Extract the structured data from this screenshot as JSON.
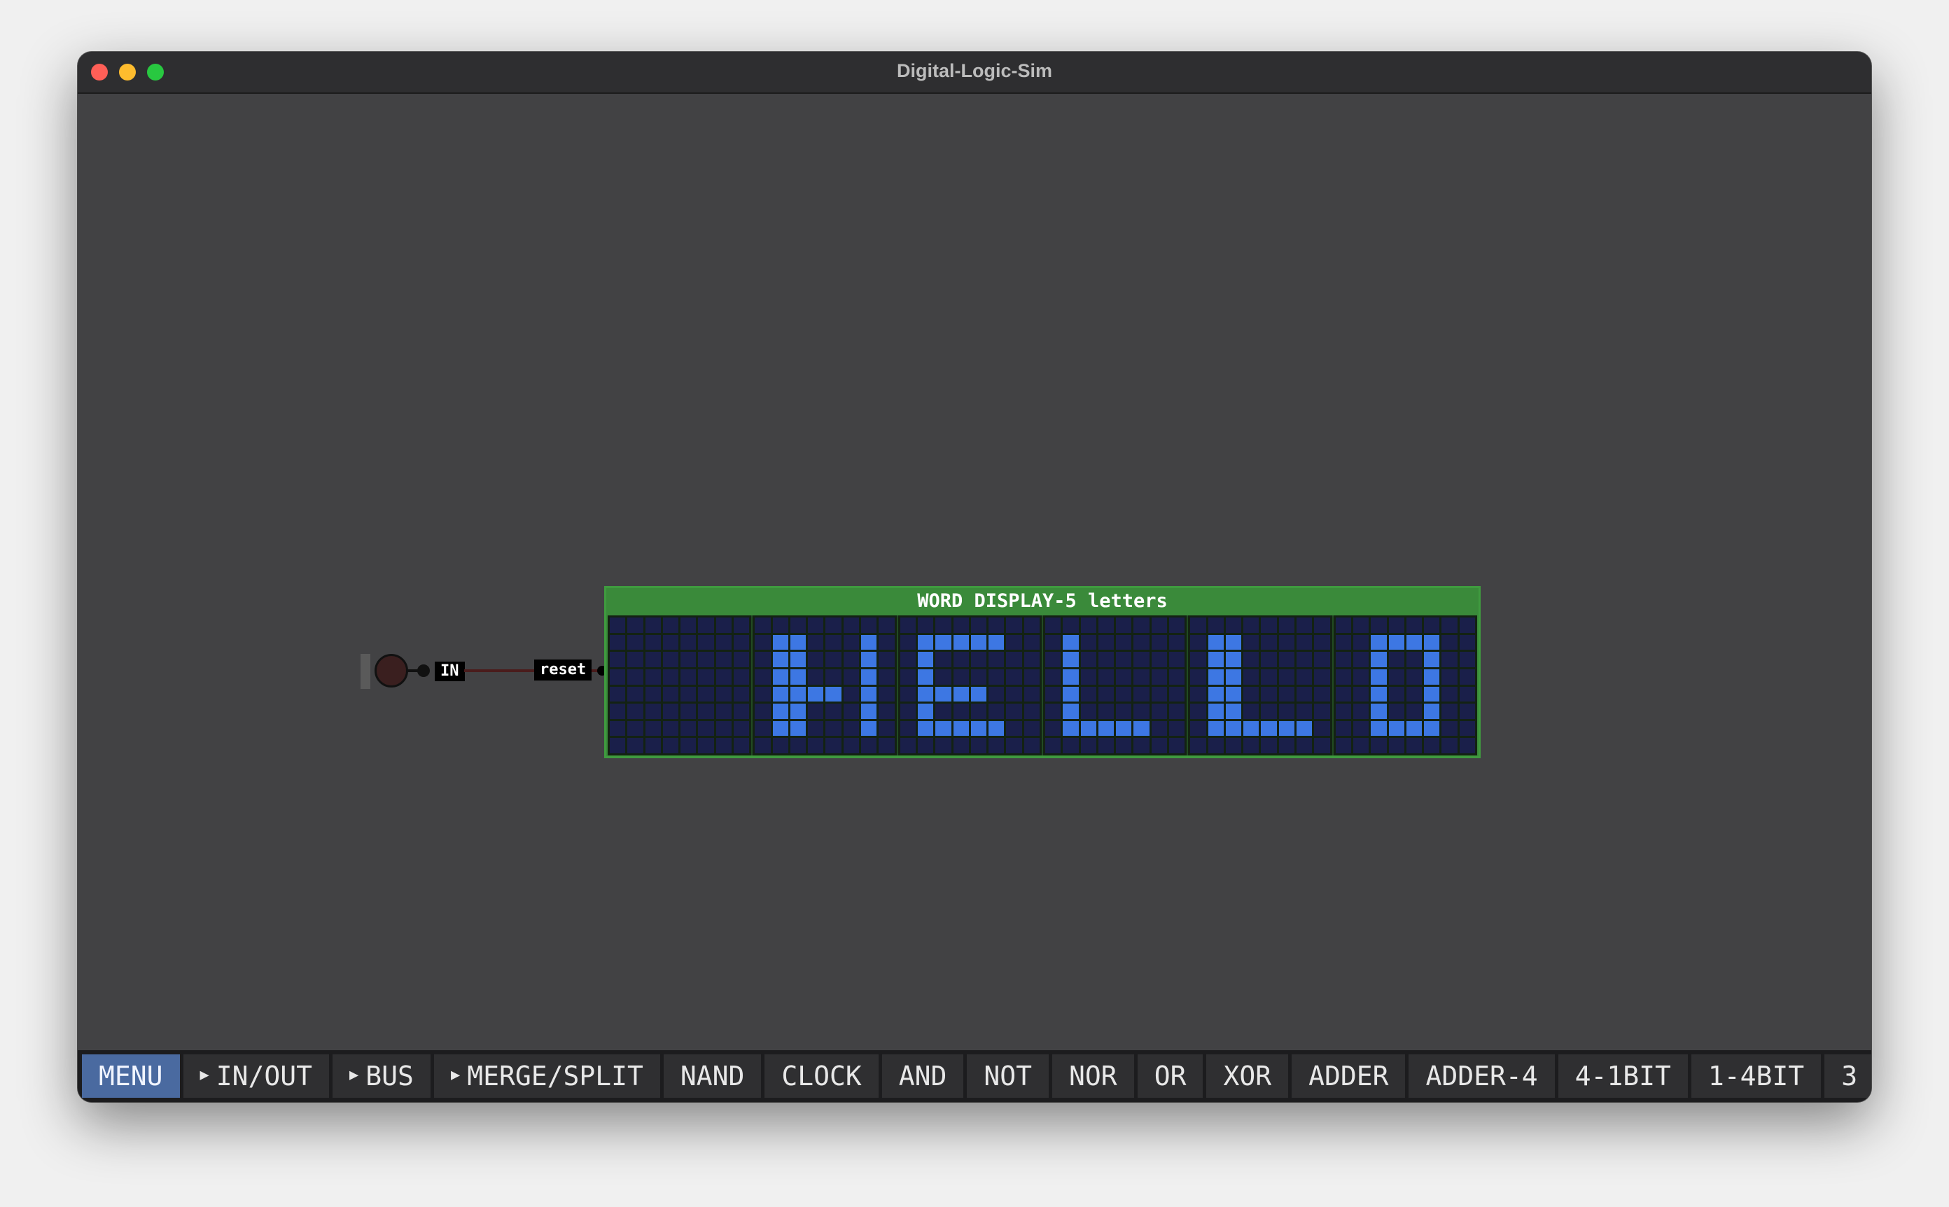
{
  "window": {
    "title": "Digital-Logic-Sim"
  },
  "canvas": {
    "input_pin": {
      "label": "IN",
      "state": "off"
    },
    "wire": {
      "color": "#4a1c1c"
    },
    "chip": {
      "title": "WORD DISPLAY-5 letters",
      "input_label": "reset",
      "colors": {
        "body": "#3a8a3a",
        "pixel_on": "#3d77e3",
        "pixel_off": "#1a1f4a"
      },
      "letters": [
        [
          "........",
          "........",
          "........",
          "........",
          "........",
          "........",
          "........",
          "........"
        ],
        [
          "........",
          ".##...#.",
          ".##...#.",
          ".##...#.",
          ".####.#.",
          ".##...#.",
          ".##...#.",
          "........"
        ],
        [
          "........",
          ".#####..",
          ".#......",
          ".#......",
          ".####...",
          ".#......",
          ".#####..",
          "........"
        ],
        [
          "........",
          ".#......",
          ".#......",
          ".#......",
          ".#......",
          ".#......",
          ".#####..",
          "........"
        ],
        [
          "........",
          ".##.....",
          ".##.....",
          ".##.....",
          ".##.....",
          ".##.....",
          ".######.",
          "........"
        ],
        [
          "........",
          "..####..",
          "..#..#..",
          "..#..#..",
          "..#..#..",
          "..#..#..",
          "..####..",
          "........"
        ]
      ]
    }
  },
  "toolbar": {
    "items": [
      {
        "label": "MENU",
        "active": true,
        "arrow": false
      },
      {
        "label": "IN/OUT",
        "active": false,
        "arrow": true
      },
      {
        "label": "BUS",
        "active": false,
        "arrow": true
      },
      {
        "label": "MERGE/SPLIT",
        "active": false,
        "arrow": true
      },
      {
        "label": "NAND",
        "active": false,
        "arrow": false
      },
      {
        "label": "CLOCK",
        "active": false,
        "arrow": false
      },
      {
        "label": "AND",
        "active": false,
        "arrow": false
      },
      {
        "label": "NOT",
        "active": false,
        "arrow": false
      },
      {
        "label": "NOR",
        "active": false,
        "arrow": false
      },
      {
        "label": "OR",
        "active": false,
        "arrow": false
      },
      {
        "label": "XOR",
        "active": false,
        "arrow": false
      },
      {
        "label": "ADDER",
        "active": false,
        "arrow": false
      },
      {
        "label": "ADDER-4",
        "active": false,
        "arrow": false
      },
      {
        "label": "4-1BIT",
        "active": false,
        "arrow": false
      },
      {
        "label": "1-4BIT",
        "active": false,
        "arrow": false
      },
      {
        "label": "3",
        "active": false,
        "arrow": false
      }
    ]
  }
}
